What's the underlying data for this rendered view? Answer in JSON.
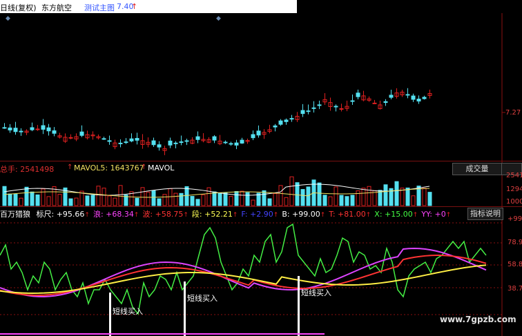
{
  "header": {
    "period": "日线(复权)",
    "stock_name": "东方航空",
    "indicator_title": "测试主图",
    "indicator_value": "7.40",
    "up_arrow": "↑"
  },
  "price_axis": {
    "label": "7.27"
  },
  "volume_panel": {
    "total_label": "总手: 2541498",
    "mavol5_label": "MAVOL5: 1643767",
    "mavol10_label": "MAVOL",
    "dropdown": "成交量",
    "axis_labels": [
      "2541",
      "1294",
      "1000"
    ]
  },
  "indicator_panel": {
    "name": "百万猎狼",
    "items": [
      {
        "text": "标尺: +95.66",
        "color": "#ffffff"
      },
      {
        "text": "浪: +68.34",
        "color": "#ff44ff"
      },
      {
        "text": "波: +58.75",
        "color": "#ff3333"
      },
      {
        "text": "段: +52.21",
        "color": "#ffff55"
      },
      {
        "text": "F: +2.90",
        "color": "#4444ff"
      },
      {
        "text": "B: +99.00",
        "color": "#ffffff"
      },
      {
        "text": "T: +81.00",
        "color": "#ff3333"
      },
      {
        "text": "X: +15.00",
        "color": "#44ff44"
      },
      {
        "text": "YY: +0",
        "color": "#ff44ff"
      }
    ],
    "help_button": "指标说明",
    "axis_labels": [
      "+99",
      "78.9",
      "58.8",
      "38.7"
    ],
    "buy_signals": [
      "短线买入",
      "短线买入",
      "短线买入"
    ]
  },
  "watermark": "www.7gpzb.com",
  "colors": {
    "up": "#e02020",
    "down": "#54e0f0",
    "axis": "#8b1010"
  }
}
